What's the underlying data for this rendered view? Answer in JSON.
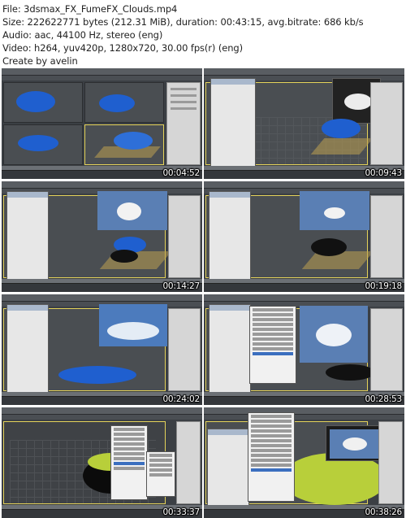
{
  "header": {
    "file": "File: 3dsmax_FX_FumeFX_Clouds.mp4",
    "size": "Size: 222622771 bytes (212.31 MiB), duration: 00:43:15, avg.bitrate: 686 kb/s",
    "audio": "Audio: aac, 44100 Hz, stereo (eng)",
    "video": "Video: h264, yuv420p, 1280x720, 30.00 fps(r) (eng)",
    "credit": "Create by avelin"
  },
  "thumbnails": [
    {
      "timestamp": "00:04:52"
    },
    {
      "timestamp": "00:09:43"
    },
    {
      "timestamp": "00:14:27"
    },
    {
      "timestamp": "00:19:18"
    },
    {
      "timestamp": "00:24:02"
    },
    {
      "timestamp": "00:28:53"
    },
    {
      "timestamp": "00:33:37"
    },
    {
      "timestamp": "00:38:26"
    }
  ],
  "colors": {
    "viewport": "#4a4e52",
    "active_viewport_border": "#e5d35a",
    "smoke_blue": "#1f5fcf",
    "dark_mesh": "#111111",
    "yellow_mesh": "#b8cf3a",
    "sky_blue": "#5a88c7"
  }
}
